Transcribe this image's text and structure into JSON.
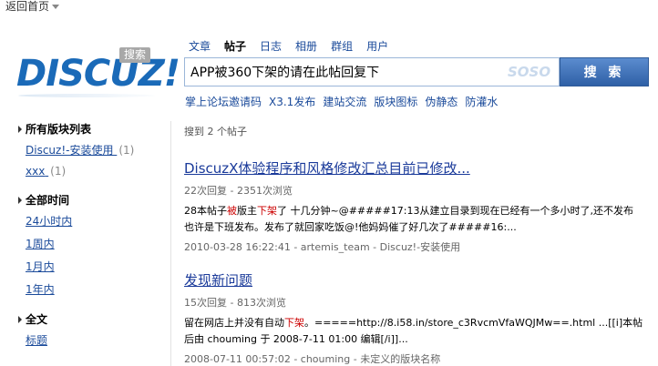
{
  "topbar": {
    "back_home": "返回首页"
  },
  "logo": {
    "text": "DISCUZ",
    "excl": "!",
    "badge": "搜索"
  },
  "search": {
    "tabs": [
      "文章",
      "帖子",
      "日志",
      "相册",
      "群组",
      "用户"
    ],
    "active_tab": "帖子",
    "query": "APP被360下架的请在此帖回复下",
    "soso": "SOSO",
    "button": "搜 索",
    "hot_links": [
      "掌上论坛邀请码",
      "X3.1发布",
      "建站交流",
      "版块图标",
      "伪静态",
      "防灌水"
    ]
  },
  "sidebar": {
    "forums_heading": "所有版块列表",
    "forums": [
      {
        "label": "Discuz!-安装使用",
        "count": "(1)"
      },
      {
        "label": "xxx",
        "count": "(1)"
      }
    ],
    "time_heading": "全部时间",
    "time_items": [
      "24小时内",
      "1周内",
      "1月内",
      "1年内"
    ],
    "fulltext_heading": "全文",
    "fulltext_items": [
      "标题"
    ]
  },
  "results": {
    "count_text": "搜到 2 个帖子",
    "items": [
      {
        "title": "DiscuzX体验程序和风格修改汇总目前已修改...",
        "meta": "22次回复 - 2351次浏览",
        "line1_a": "28本帖子",
        "line1_hl1": "被",
        "line1_b": "版主",
        "line1_hl2": "下架",
        "line1_c": "了 十几分钟~@#####17:13从建立目录到现在已经有一个多小时了,还不发布",
        "line2": "也许是下班发布。发布了就回家吃饭@!他妈妈催了好几次了#####16:...",
        "footer": "2010-03-28 16:22:41 - artemis_team - Discuz!-安装使用"
      },
      {
        "title": "发现新问题",
        "meta": "15次回复 - 813次浏览",
        "line1_a": "留在网店上并没有自动",
        "line1_hl1": "下架",
        "line1_b": "。=====http://8.i58.in/store_c3RvcmVfaWQJMw==.html ...[[i]本帖",
        "line2": "后由 chouming 于 2008-7-11 01:00 编辑[/i]]...",
        "footer": "2008-07-11 00:57:02 - chouming - 未定义的版块名称"
      }
    ]
  },
  "colors": {
    "link": "#1a4a9a",
    "title_link": "#1a3a9a",
    "highlight": "#cc0000",
    "button": "#3e6fb3",
    "logo": "#1a6ab8"
  }
}
